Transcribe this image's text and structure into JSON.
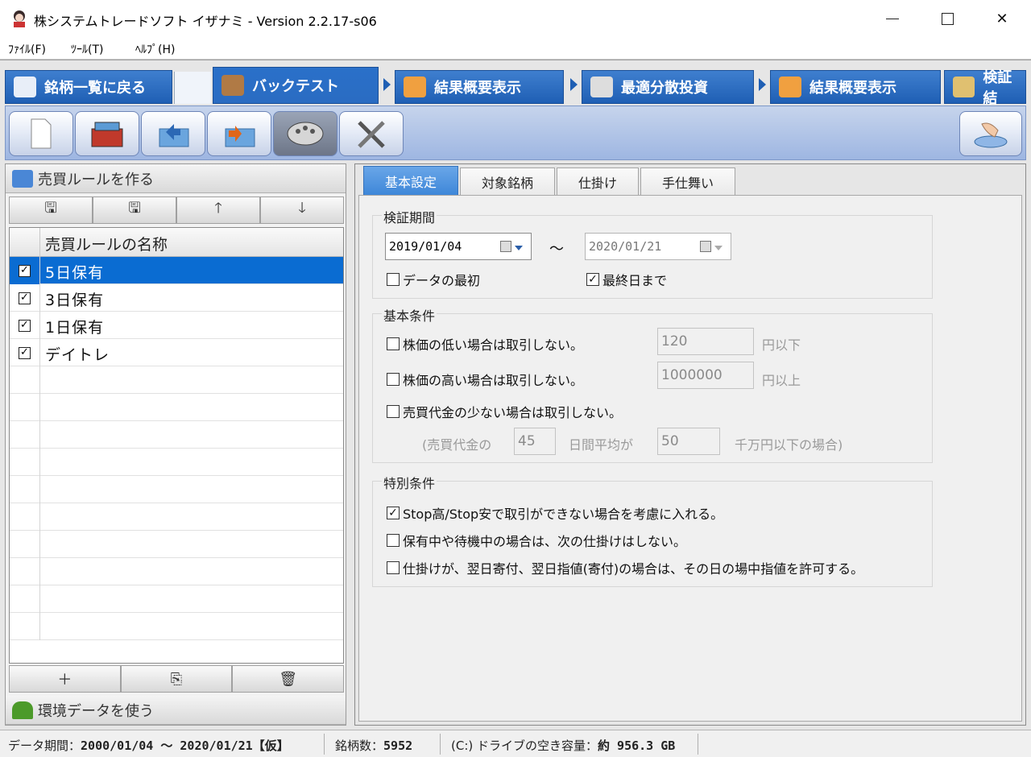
{
  "window": {
    "title": "株システムトレードソフト イザナミ - Version 2.2.17-s06",
    "minimize_glyph": "—",
    "close_glyph": "✕"
  },
  "menu": [
    {
      "label": "ﾌｧｲﾙ(F)"
    },
    {
      "label": "ﾂｰﾙ(T)"
    },
    {
      "label": "ﾍﾙﾌﾟ(H)"
    }
  ],
  "main_tabs": [
    {
      "label": "銘柄一覧に戻る",
      "icon": "eye-icon"
    },
    {
      "label": "バックテスト",
      "icon": "bag-icon"
    },
    {
      "label": "結果概要表示",
      "icon": "chart-icon"
    },
    {
      "label": "最適分散投資",
      "icon": "calculator-icon"
    },
    {
      "label": "結果概要表示",
      "icon": "bar-chart-icon"
    },
    {
      "label": "検証結",
      "icon": "desk-icon"
    }
  ],
  "toolbar": {
    "buttons": [
      {
        "icon": "new-document-icon"
      },
      {
        "icon": "open-toolbox-icon"
      },
      {
        "icon": "import-folder-icon"
      },
      {
        "icon": "export-folder-icon"
      },
      {
        "icon": "palette-icon"
      },
      {
        "icon": "tools-icon"
      }
    ],
    "right_button_icon": "touch-button-icon"
  },
  "left_panel": {
    "section1_title": "売買ルールを作る",
    "top_buttons": [
      "🖫",
      "🖫",
      "🡑",
      "🡓"
    ],
    "grid_header": "売買ルールの名称",
    "rules": [
      {
        "name": "5日保有",
        "checked": true,
        "selected": true
      },
      {
        "name": "3日保有",
        "checked": true,
        "selected": false
      },
      {
        "name": "1日保有",
        "checked": true,
        "selected": false
      },
      {
        "name": "デイトレ",
        "checked": true,
        "selected": false
      }
    ],
    "bottom_buttons": [
      "＋",
      "⎘",
      "🗑"
    ],
    "section2_title": "環境データを使う"
  },
  "right_panel": {
    "tabs": [
      "基本設定",
      "対象銘柄",
      "仕掛け",
      "手仕舞い"
    ],
    "period": {
      "label": "検証期間",
      "start_date": "2019/01/04",
      "tilde": "～",
      "end_date": "2020/01/21",
      "from_start_label": "データの最初",
      "from_start_checked": false,
      "to_end_label": "最終日まで",
      "to_end_checked": true
    },
    "basic": {
      "label": "基本条件",
      "low_price_label": "株価の低い場合は取引しない。",
      "low_price_value": "120",
      "low_price_unit": "円以下",
      "high_price_label": "株価の高い場合は取引しない。",
      "high_price_value": "1000000",
      "high_price_unit": "円以上",
      "volume_label": "売買代金の少ない場合は取引しない。",
      "volume_prefix": "(売買代金の",
      "volume_days": "45",
      "volume_mid": "日間平均が",
      "volume_value": "50",
      "volume_suffix": "千万円以下の場合)"
    },
    "special": {
      "label": "特別条件",
      "opt1": "Stop高/Stop安で取引ができない場合を考慮に入れる。",
      "opt1_checked": true,
      "opt2": "保有中や待機中の場合は、次の仕掛けはしない。",
      "opt2_checked": false,
      "opt3": "仕掛けが、翌日寄付、翌日指値(寄付)の場合は、その日の場中指値を許可する。",
      "opt3_checked": false
    }
  },
  "status": {
    "period_label": "データ期間：",
    "period_value": "2000/01/04 ～ 2020/01/21【仮】",
    "count_label": "銘柄数：",
    "count_value": "5952",
    "disk_label": "(C:) ドライブの空き容量：",
    "disk_value": "約 956.3 GB"
  }
}
